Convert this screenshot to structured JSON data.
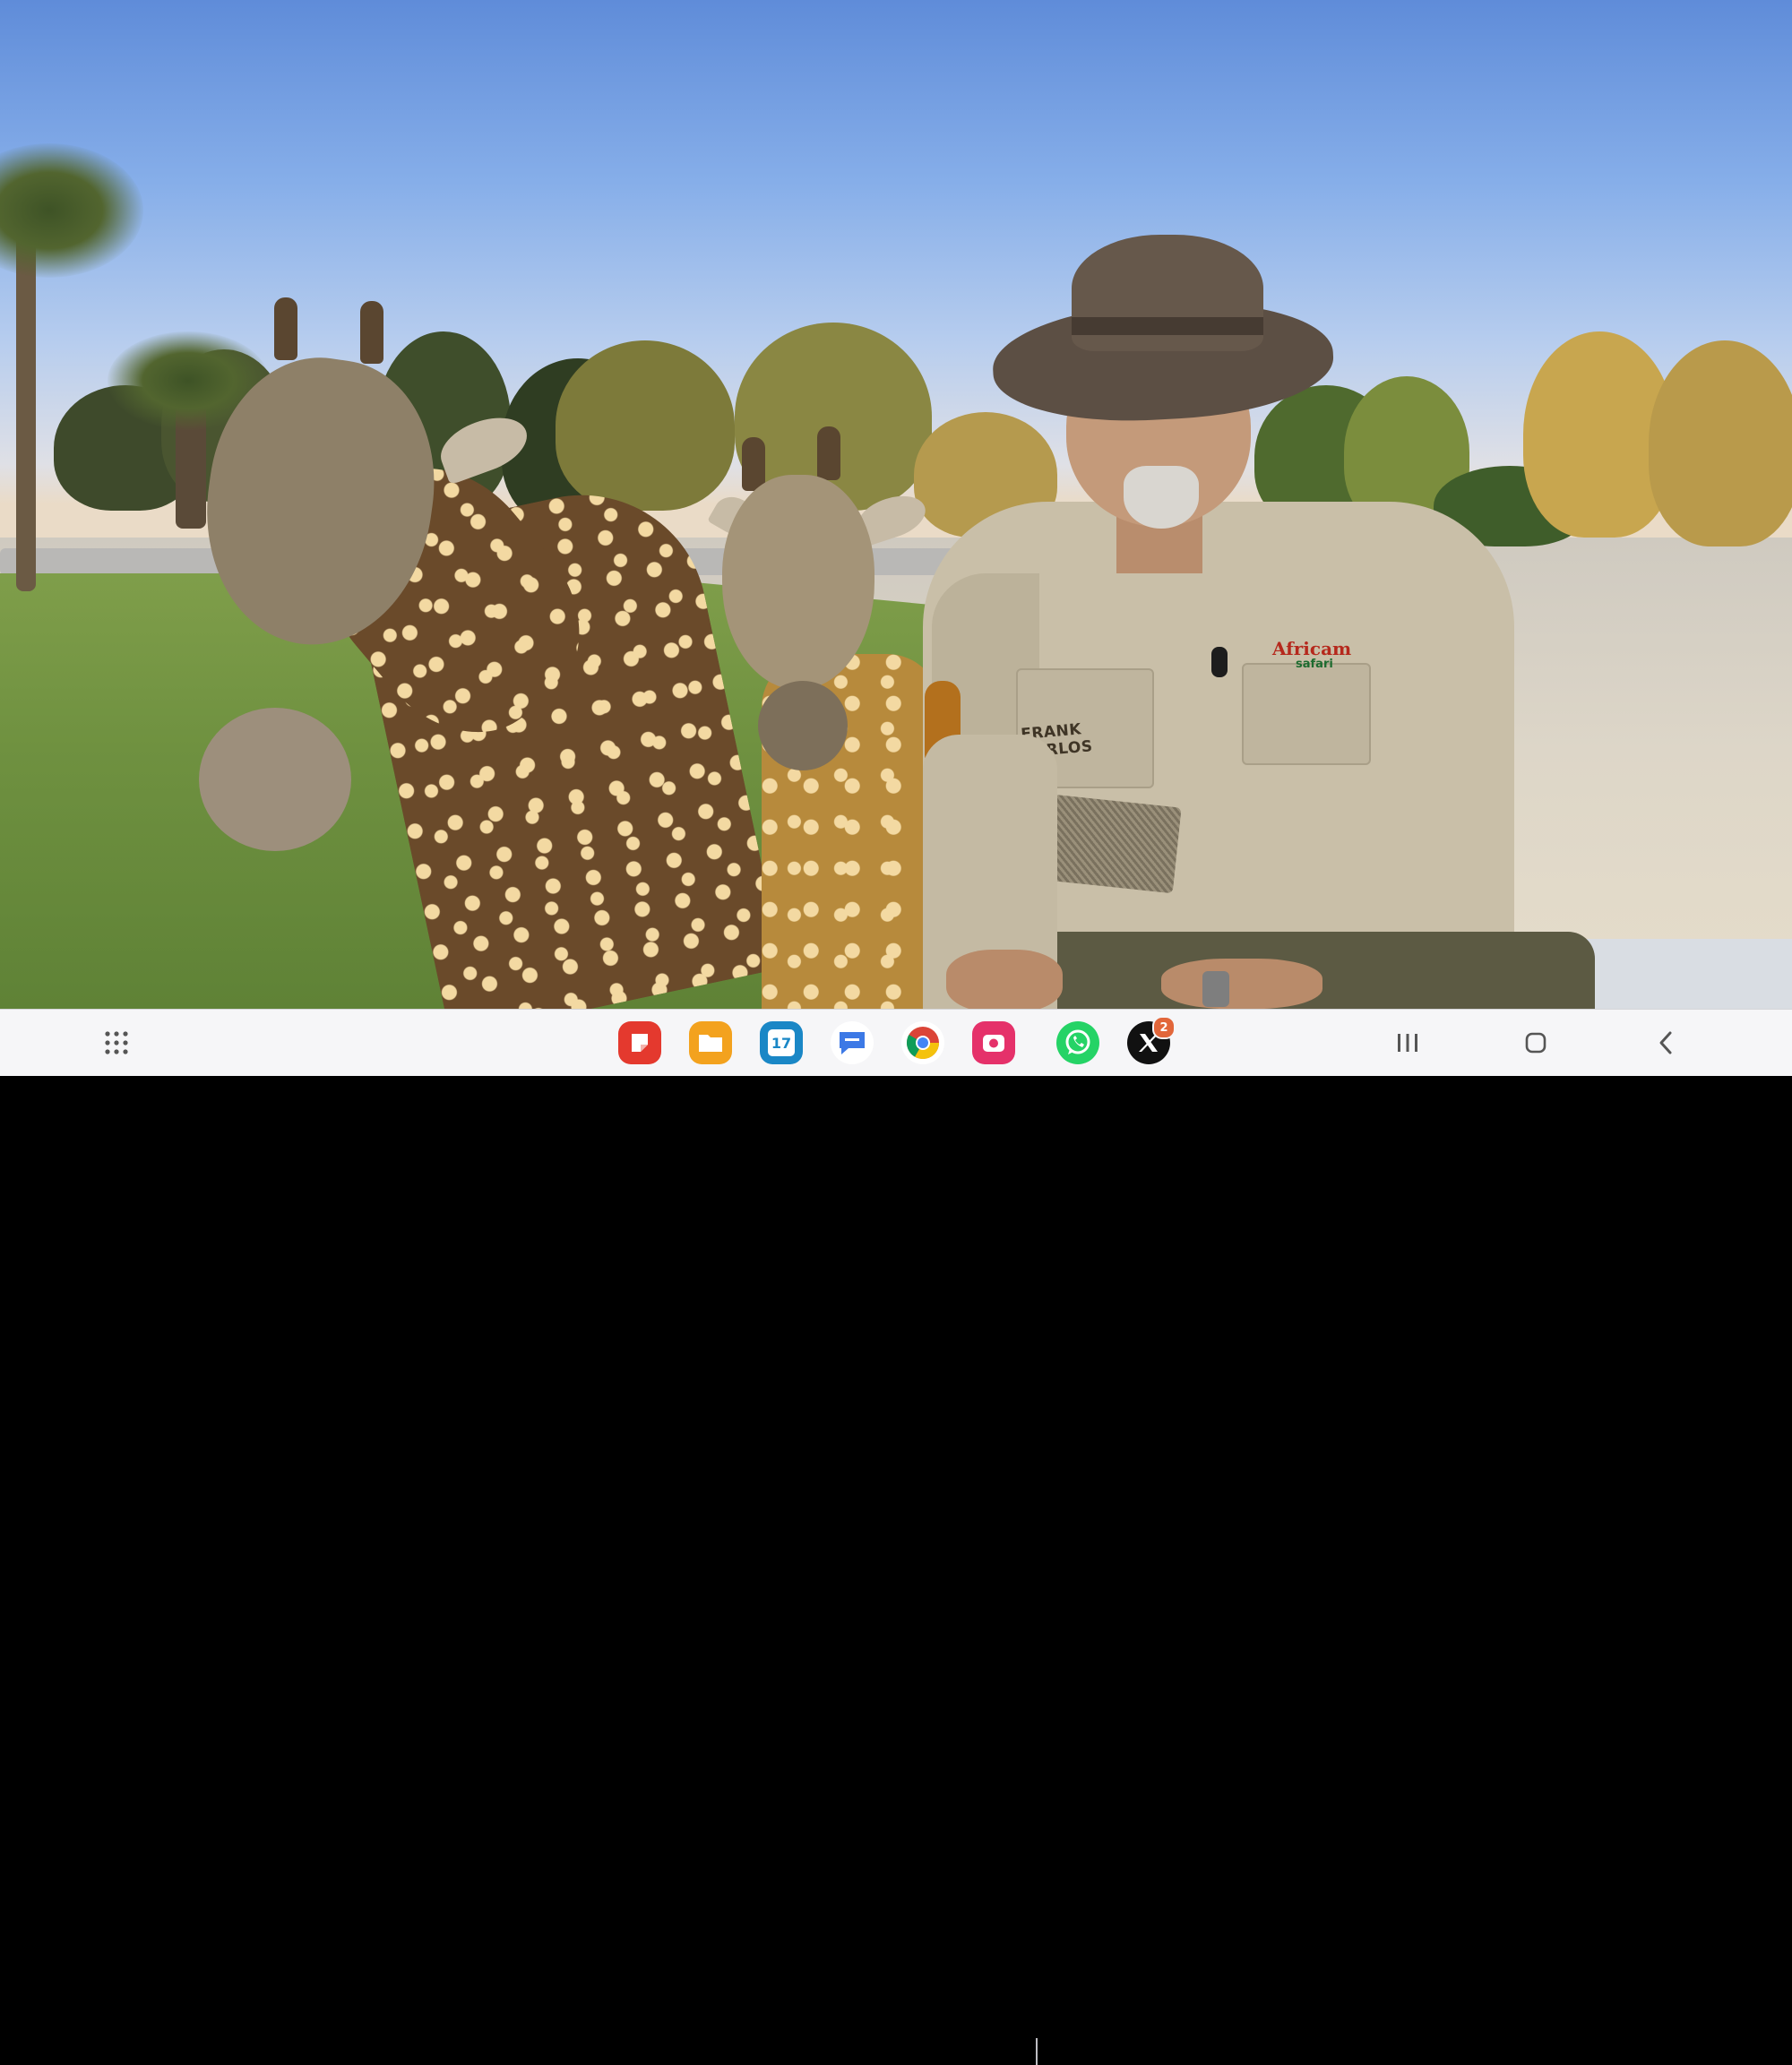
{
  "video": {
    "name_tag": "FRANK CARLOS",
    "shirt_logo": "Africam",
    "shirt_logo_sub": "safari"
  },
  "taskbar": {
    "app_drawer_icon": "apps-grid-icon",
    "pinned_apps": [
      {
        "name": "Samsung Notes",
        "icon": "notes-icon",
        "color": "#e4392e"
      },
      {
        "name": "My Files",
        "icon": "folder-icon",
        "color": "#f3a21e"
      },
      {
        "name": "Calendar",
        "icon": "calendar-icon",
        "color": "#1a87c6",
        "label": "17"
      },
      {
        "name": "Messages",
        "icon": "messages-icon",
        "color": "#3c79e6"
      },
      {
        "name": "Chrome",
        "icon": "chrome-icon",
        "color": "#ffffff"
      },
      {
        "name": "Screen Recorder",
        "icon": "camera-icon",
        "color": "#e5316a"
      },
      {
        "name": "WhatsApp",
        "icon": "whatsapp-icon",
        "color": "#25d366"
      },
      {
        "name": "X",
        "icon": "x-icon",
        "color": "#111111",
        "badge": "2"
      }
    ],
    "nav": {
      "recents_icon": "recents-icon",
      "home_icon": "home-icon",
      "back_icon": "back-icon"
    }
  }
}
